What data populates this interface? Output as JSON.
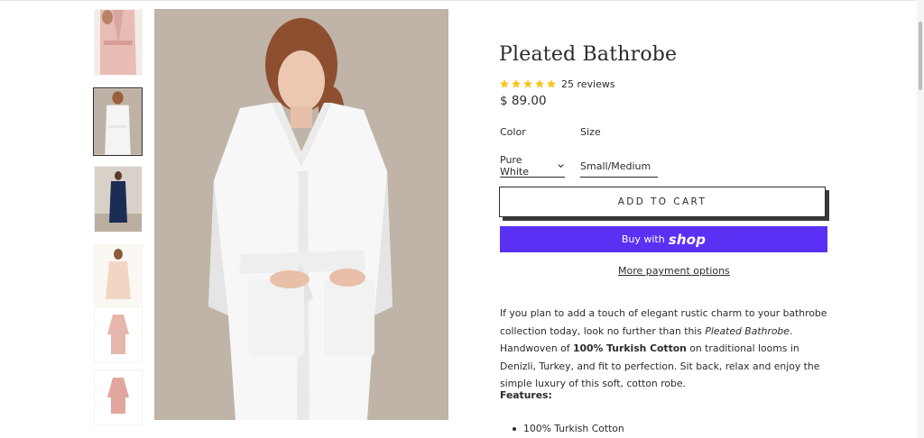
{
  "product": {
    "title": "Pleated Bathrobe",
    "reviews": "25 reviews",
    "rating_stars": 5,
    "price": "$ 89.00",
    "color_label": "Color",
    "size_label": "Size",
    "color_value": "Pure White",
    "size_value": "Small/Medium",
    "add_to_cart": "ADD TO CART",
    "buy_with": "Buy with",
    "shop_brand": "shop",
    "more_payment": "More payment options",
    "desc_1": "If you plan to add a touch of elegant rustic charm to your bathrobe collection today, look no further than this ",
    "desc_product": "Pleated Bathrobe",
    "desc_2": ". Handwoven of ",
    "desc_bold": "100% Turkish Cotton",
    "desc_3": " on traditional looms in Denizli, Turkey, and fit to perfection. Sit back, relax and enjoy the simple luxury of this soft, cotton robe.",
    "features_heading": "Features:",
    "features": [
      "100% Turkish Cotton"
    ]
  },
  "colors": {
    "accent_shop": "#5a31f4",
    "star": "#f5c518",
    "text": "#2b2b2b"
  }
}
